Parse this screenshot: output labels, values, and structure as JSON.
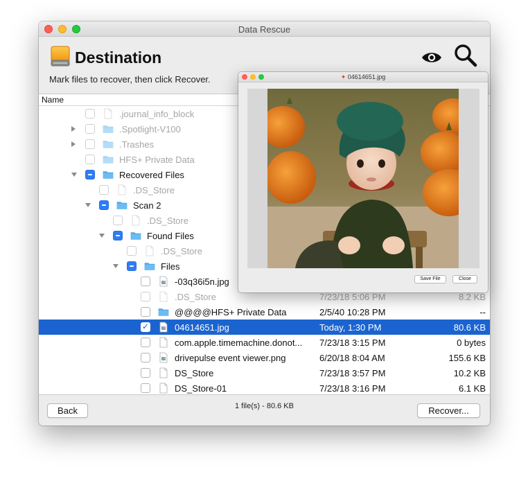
{
  "window": {
    "title": "Data Rescue"
  },
  "header": {
    "title": "Destination",
    "subtitle": "Mark files to recover, then click Recover."
  },
  "list": {
    "column_name": "Name",
    "rows": [
      {
        "name": ".journal_info_block",
        "date": "",
        "size": "",
        "state": "unchecked",
        "disclosure": "",
        "icon": "file-icon",
        "dim": true,
        "selected": false
      },
      {
        "name": ".Spotlight-V100",
        "date": "",
        "size": "",
        "state": "unchecked",
        "disclosure": "collapsed",
        "icon": "folder-icon",
        "dim": true,
        "selected": false
      },
      {
        "name": ".Trashes",
        "date": "",
        "size": "",
        "state": "unchecked",
        "disclosure": "collapsed",
        "icon": "folder-icon",
        "dim": true,
        "selected": false
      },
      {
        "name": "HFS+ Private Data",
        "date": "",
        "size": "",
        "state": "unchecked",
        "disclosure": "",
        "icon": "folder-icon",
        "dim": true,
        "selected": false
      },
      {
        "name": "Recovered Files",
        "date": "",
        "size": "",
        "state": "mixed",
        "disclosure": "expanded",
        "icon": "folder-icon",
        "dim": false,
        "selected": false
      },
      {
        "name": ".DS_Store",
        "date": "",
        "size": "",
        "state": "unchecked",
        "disclosure": "",
        "icon": "file-icon",
        "dim": true,
        "selected": false
      },
      {
        "name": "Scan 2",
        "date": "",
        "size": "",
        "state": "mixed",
        "disclosure": "expanded",
        "icon": "folder-icon",
        "dim": false,
        "selected": false
      },
      {
        "name": ".DS_Store",
        "date": "",
        "size": "",
        "state": "unchecked",
        "disclosure": "",
        "icon": "file-icon",
        "dim": true,
        "selected": false
      },
      {
        "name": "Found Files",
        "date": "",
        "size": "",
        "state": "mixed",
        "disclosure": "expanded",
        "icon": "folder-icon",
        "dim": false,
        "selected": false
      },
      {
        "name": ".DS_Store",
        "date": "",
        "size": "",
        "state": "unchecked",
        "disclosure": "",
        "icon": "file-icon",
        "dim": true,
        "selected": false
      },
      {
        "name": "Files",
        "date": "",
        "size": "",
        "state": "mixed",
        "disclosure": "expanded",
        "icon": "folder-icon",
        "dim": false,
        "selected": false
      },
      {
        "name": "-03q36i5n.jpg",
        "date": "",
        "size": "",
        "state": "unchecked",
        "disclosure": "",
        "icon": "image-file-icon",
        "dim": false,
        "selected": false
      },
      {
        "name": ".DS_Store",
        "date": "7/23/18 5:06 PM",
        "size": "8.2 KB",
        "state": "unchecked",
        "disclosure": "",
        "icon": "file-icon",
        "dim": true,
        "selected": false
      },
      {
        "name": "@@@@HFS+ Private Data",
        "date": "2/5/40 10:28 PM",
        "size": "--",
        "state": "unchecked",
        "disclosure": "",
        "icon": "folder-icon",
        "dim": false,
        "selected": false
      },
      {
        "name": "04614651.jpg",
        "date": "Today, 1:30 PM",
        "size": "80.6 KB",
        "state": "checked",
        "disclosure": "",
        "icon": "image-file-icon",
        "dim": false,
        "selected": true
      },
      {
        "name": "com.apple.timemachine.donot...",
        "date": "7/23/18 3:15 PM",
        "size": "0 bytes",
        "state": "unchecked",
        "disclosure": "",
        "icon": "file-icon",
        "dim": false,
        "selected": false
      },
      {
        "name": "drivepulse event viewer.png",
        "date": "6/20/18 8:04 AM",
        "size": "155.6 KB",
        "state": "unchecked",
        "disclosure": "",
        "icon": "image-file-icon",
        "dim": false,
        "selected": false
      },
      {
        "name": "DS_Store",
        "date": "7/23/18 3:57 PM",
        "size": "10.2 KB",
        "state": "unchecked",
        "disclosure": "",
        "icon": "file-icon",
        "dim": false,
        "selected": false
      },
      {
        "name": "DS_Store-01",
        "date": "7/23/18 3:16 PM",
        "size": "6.1 KB",
        "state": "unchecked",
        "disclosure": "",
        "icon": "file-icon",
        "dim": false,
        "selected": false
      }
    ]
  },
  "footer": {
    "back_label": "Back",
    "status": "1 file(s) - 80.6 KB",
    "recover_label": "Recover..."
  },
  "preview": {
    "title": "04614651.jpg",
    "save_label": "Save File",
    "close_label": "Close"
  },
  "colors": {
    "selection": "#1b64d0",
    "checkbox_accent": "#2f7cf6",
    "folder": "#5ab0ee",
    "drive": "#f6a623"
  }
}
